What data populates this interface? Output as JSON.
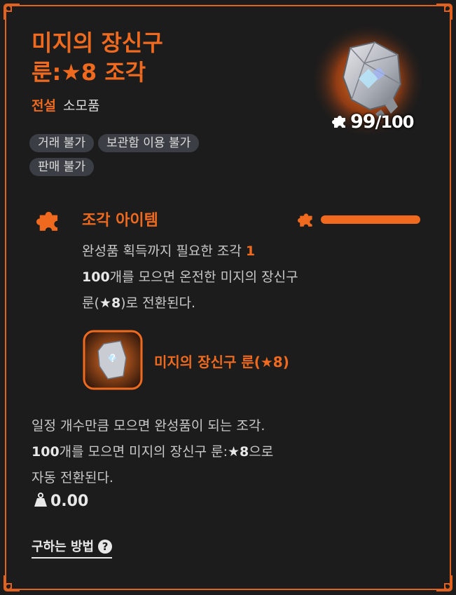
{
  "item": {
    "title_line1": "미지의 장신구",
    "title_line2": "룬:★8 조각",
    "grade": "전설",
    "category": "소모품",
    "tags": [
      "거래 불가",
      "보관함 이용 불가",
      "판매 불가"
    ],
    "count_owned": "99",
    "count_max": "/100",
    "icon": "mystery-rune-fragment-icon"
  },
  "section": {
    "title": "조각 아이템",
    "progress": 0.99,
    "desc_line1_prefix": "완성품 획득까지 필요한 조각 ",
    "desc_line1_num": "1",
    "desc_line2_num": "100",
    "desc_line2_rest": "개를 모으면 온전한 미지의 장신구",
    "desc_line3_prefix": "룬(",
    "desc_line3_bold": "★8",
    "desc_line3_rest": ")로 전환된다."
  },
  "result": {
    "name": "미지의 장신구 룬(★8)"
  },
  "description": {
    "line1": "일정 개수만큼 모으면 완성품이 되는 조각.",
    "line2_num": "100",
    "line2_mid": "개를 모으면 미지의 장신구 룬:",
    "line2_bold": "★8",
    "line2_end": "으로",
    "line3": "자동 전환된다."
  },
  "weight": "0.00",
  "how_to_obtain": "구하는 방법",
  "help_glyph": "?",
  "colors": {
    "accent": "#ef6a1f",
    "background": "#1c1c1c",
    "tag_bg": "#3b3f45"
  }
}
